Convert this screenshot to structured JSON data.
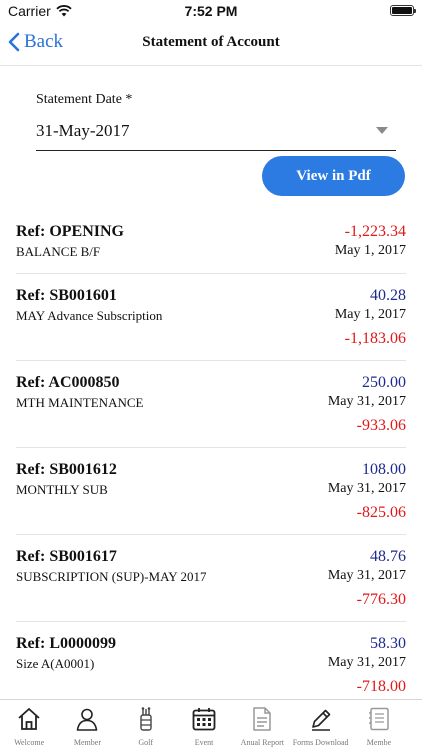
{
  "status": {
    "carrier": "Carrier",
    "time": "7:52 PM"
  },
  "nav": {
    "back_label": "Back",
    "title": "Statement of Account"
  },
  "form": {
    "date_label": "Statement Date *",
    "date_value": "31-May-2017"
  },
  "pdf_button": "View in Pdf",
  "colors": {
    "accent": "#2b7be3",
    "negative": "#e01818",
    "positive": "#1f2a8c"
  },
  "entries": [
    {
      "ref": "Ref: OPENING",
      "desc": "BALANCE B/F",
      "amount": "-1,223.34",
      "date": "May 1, 2017",
      "balance": ""
    },
    {
      "ref": "Ref: SB001601",
      "desc": "MAY Advance Subscription",
      "amount": "40.28",
      "date": "May 1, 2017",
      "balance": "-1,183.06"
    },
    {
      "ref": "Ref: AC000850",
      "desc": "MTH MAINTENANCE",
      "amount": "250.00",
      "date": "May 31, 2017",
      "balance": "-933.06"
    },
    {
      "ref": "Ref: SB001612",
      "desc": "MONTHLY SUB",
      "amount": "108.00",
      "date": "May 31, 2017",
      "balance": "-825.06"
    },
    {
      "ref": "Ref: SB001617",
      "desc": "SUBSCRIPTION (SUP)-MAY 2017",
      "amount": "48.76",
      "date": "May 31, 2017",
      "balance": "-776.30"
    },
    {
      "ref": "Ref: L0000099",
      "desc": "Size A(A0001)",
      "amount": "58.30",
      "date": "May 31, 2017",
      "balance": "-718.00"
    }
  ],
  "tabs": [
    {
      "label": "Welcome",
      "icon": "home-icon"
    },
    {
      "label": "Member",
      "icon": "person-icon"
    },
    {
      "label": "Golf",
      "icon": "golf-bag-icon"
    },
    {
      "label": "Event",
      "icon": "calendar-icon"
    },
    {
      "label": "Anual Report",
      "icon": "document-icon"
    },
    {
      "label": "Forms Download",
      "icon": "pencil-icon"
    },
    {
      "label": "Membe",
      "icon": "book-icon"
    }
  ]
}
